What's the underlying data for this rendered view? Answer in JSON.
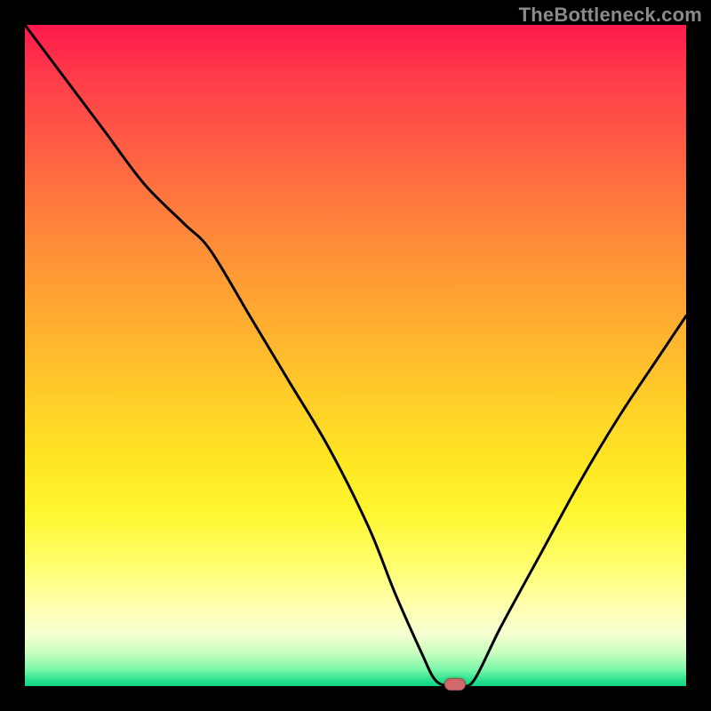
{
  "watermark": "TheBottleneck.com",
  "colors": {
    "frame": "#000000",
    "curve": "#000000",
    "marker": "#d06a6a",
    "gradient_stops": [
      "#ff1a4c",
      "#ff3c4a",
      "#ff5c44",
      "#ff7d3d",
      "#ff9a35",
      "#ffb62e",
      "#ffd227",
      "#ffe823",
      "#fff731",
      "#ffff71",
      "#ffffb0",
      "#f6ffd1",
      "#c8ffbe",
      "#7bf7a8",
      "#2de28e",
      "#0fd483"
    ]
  },
  "chart_data": {
    "type": "line",
    "title": "",
    "xlabel": "",
    "ylabel": "",
    "x_range": [
      0,
      100
    ],
    "y_range": [
      0,
      100
    ],
    "note": "V-shaped bottleneck curve; x is normalized component balance, y is mismatch percentage. Minimum (optimal balance) marked by the pill. Values estimated from pixel positions.",
    "series": [
      {
        "name": "bottleneck-curve",
        "x": [
          0,
          6,
          12,
          18,
          24,
          28,
          34,
          40,
          46,
          52,
          56,
          60,
          62,
          64,
          66,
          68,
          72,
          78,
          84,
          90,
          96,
          100
        ],
        "y": [
          100,
          92,
          84,
          76,
          70,
          66,
          56,
          46,
          36,
          24,
          14,
          5,
          1,
          0,
          0,
          1,
          9,
          20,
          31,
          41,
          50,
          56
        ]
      }
    ],
    "marker": {
      "x": 65,
      "y": 0
    },
    "axes_visible": false,
    "grid": false
  }
}
